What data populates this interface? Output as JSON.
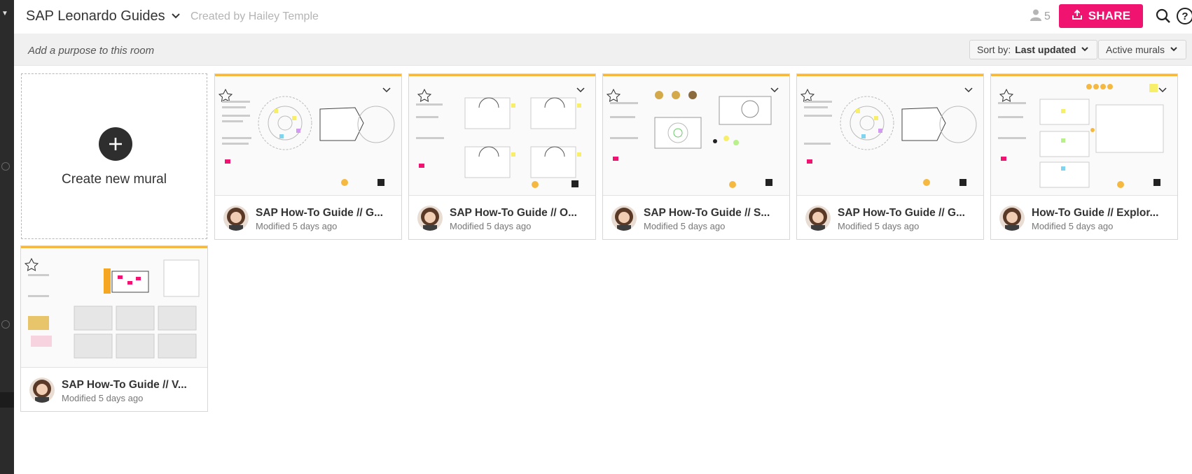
{
  "header": {
    "room_title": "SAP Leonardo Guides",
    "created_by": "Created by Hailey Temple",
    "member_count": "5",
    "share_label": "SHARE"
  },
  "purpose_bar": {
    "placeholder": "Add a purpose to this room",
    "sort_prefix": "Sort by:",
    "sort_value": "Last updated",
    "filter_label": "Active murals"
  },
  "create_card": {
    "label": "Create new mural"
  },
  "murals": [
    {
      "title": "SAP How-To Guide // G...",
      "modified": "Modified 5 days ago"
    },
    {
      "title": "SAP How-To Guide // O...",
      "modified": "Modified 5 days ago"
    },
    {
      "title": "SAP How-To Guide // S...",
      "modified": "Modified 5 days ago"
    },
    {
      "title": "SAP How-To Guide // G...",
      "modified": "Modified 5 days ago"
    },
    {
      "title": "How-To Guide // Explor...",
      "modified": "Modified 5 days ago"
    },
    {
      "title": "SAP How-To Guide // V...",
      "modified": "Modified 5 days ago"
    }
  ],
  "colors": {
    "share": "#f0136f",
    "rail": "#2b2b2b",
    "purpose_bg": "#f0f0f0"
  }
}
